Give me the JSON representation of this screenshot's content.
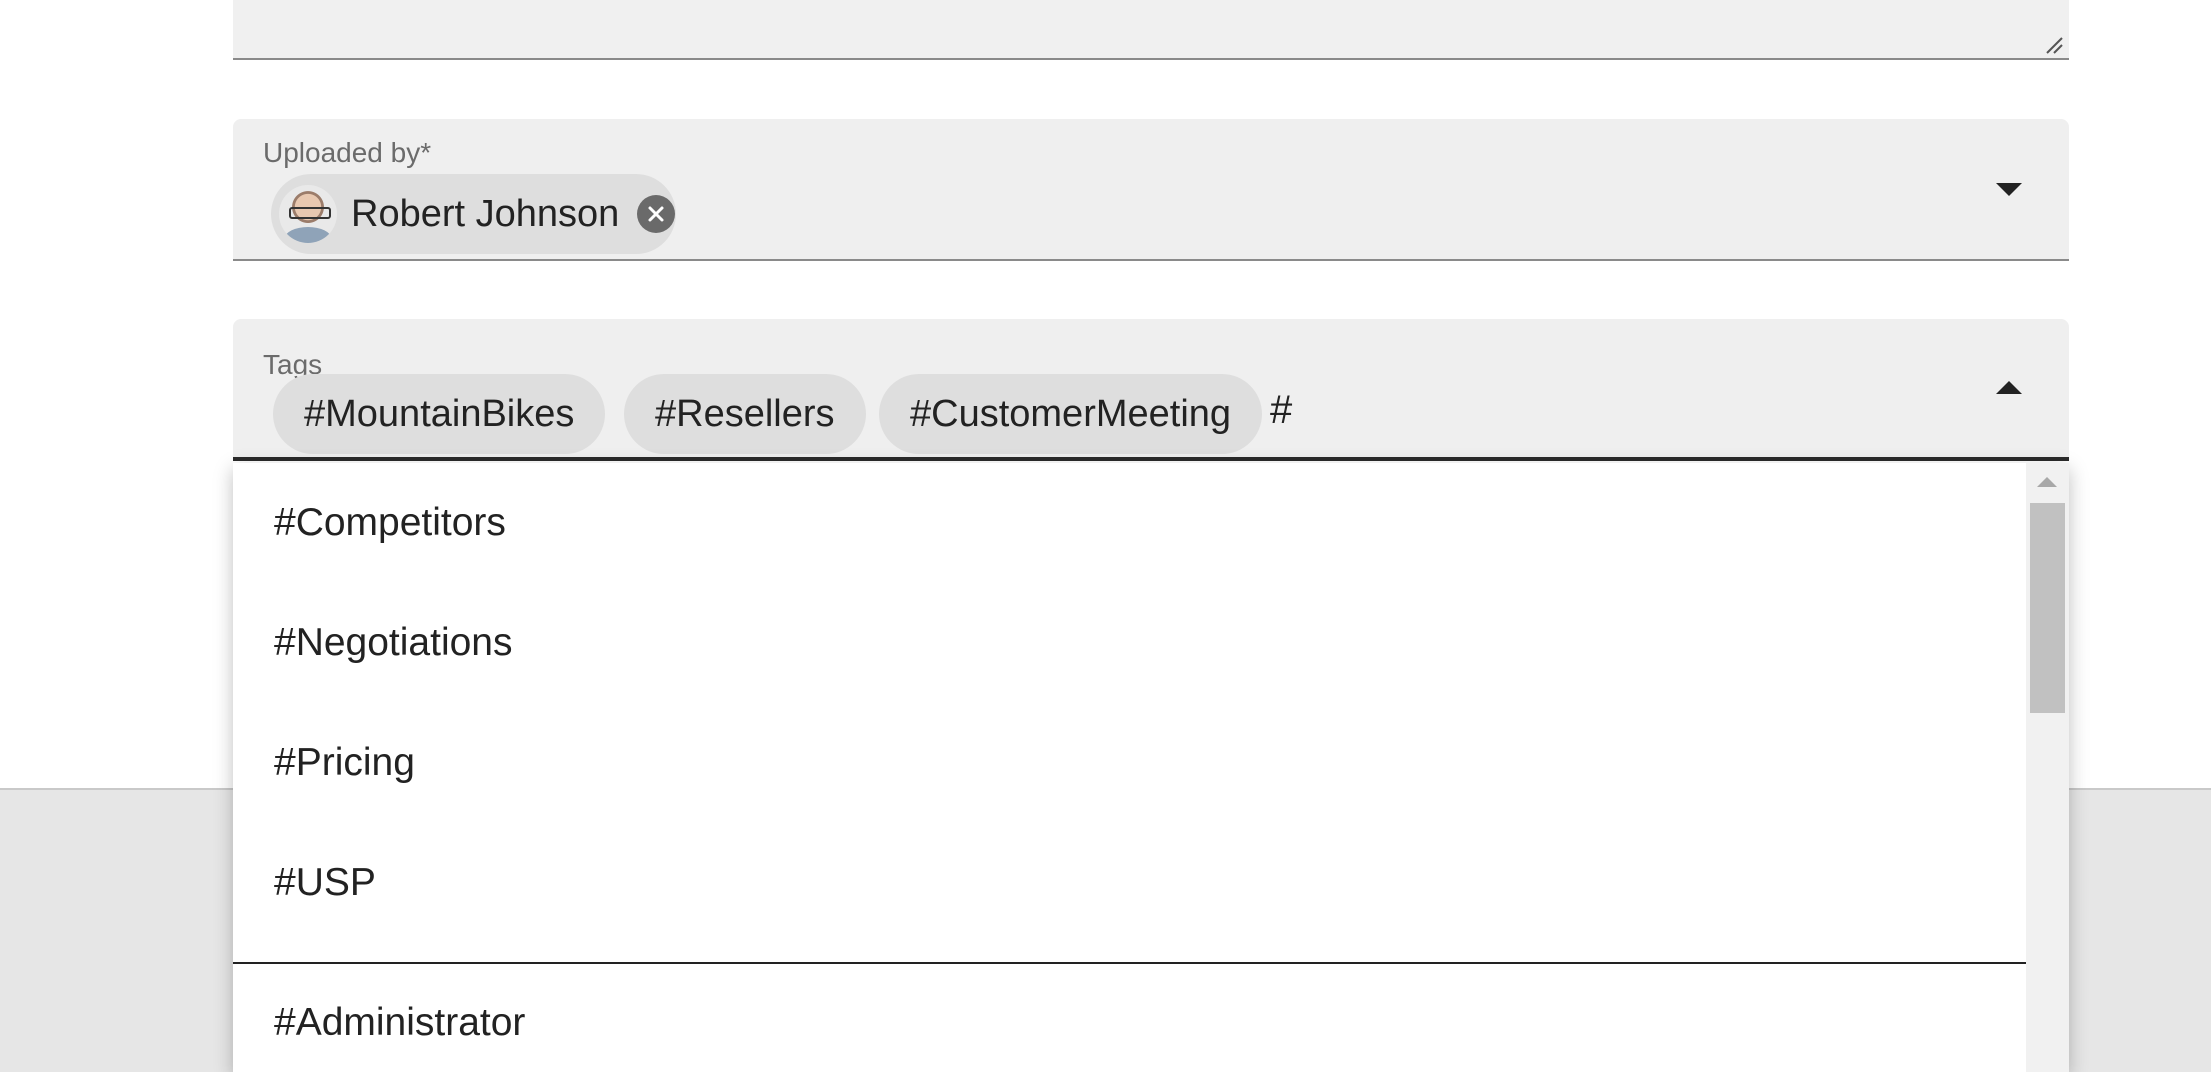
{
  "uploaded_by": {
    "label": "Uploaded by*",
    "selected_user": {
      "name": "Robert Johnson",
      "avatar_icon": "user-avatar"
    },
    "remove_icon": "close-circle-icon",
    "dropdown_icon": "caret-down-icon"
  },
  "tags": {
    "label": "Tags",
    "selected": [
      "#MountainBikes",
      "#Resellers",
      "#CustomerMeeting"
    ],
    "input_value": "#",
    "dropdown_icon": "caret-up-icon"
  },
  "tag_options": [
    "#Competitors",
    "#Negotiations",
    "#Pricing",
    "#USP",
    "#Administrator"
  ],
  "colors": {
    "field_background": "#efefef",
    "chip_background": "#dedede",
    "text": "#222222",
    "label": "#6b6b6b"
  }
}
